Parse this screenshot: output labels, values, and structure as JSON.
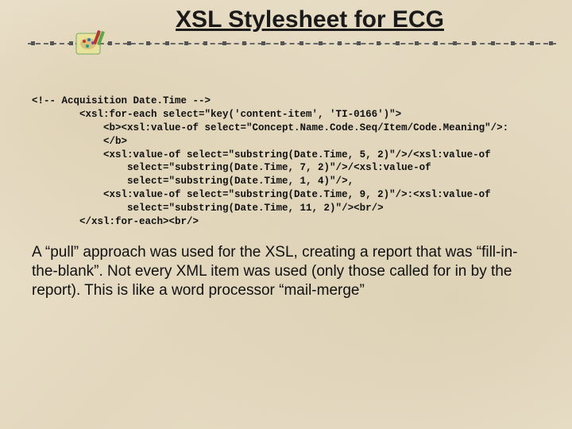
{
  "title": "XSL Stylesheet for ECG",
  "code": "<!-- Acquisition Date.Time -->\n        <xsl:for-each select=\"key('content-item', 'TI-0166')\">\n            <b><xsl:value-of select=\"Concept.Name.Code.Seq/Item/Code.Meaning\"/>:\n            </b>\n            <xsl:value-of select=\"substring(Date.Time, 5, 2)\"/>/<xsl:value-of\n                select=\"substring(Date.Time, 7, 2)\"/>/<xsl:value-of\n                select=\"substring(Date.Time, 1, 4)\"/>,\n            <xsl:value-of select=\"substring(Date.Time, 9, 2)\"/>:<xsl:value-of\n                select=\"substring(Date.Time, 11, 2)\"/><br/>\n        </xsl:for-each><br/>",
  "paragraph": "A “pull” approach was used for the XSL, creating a report that was “fill-in-the-blank”. Not every XML item was used (only those called for in by the report). This is like a word processor “mail-merge”"
}
